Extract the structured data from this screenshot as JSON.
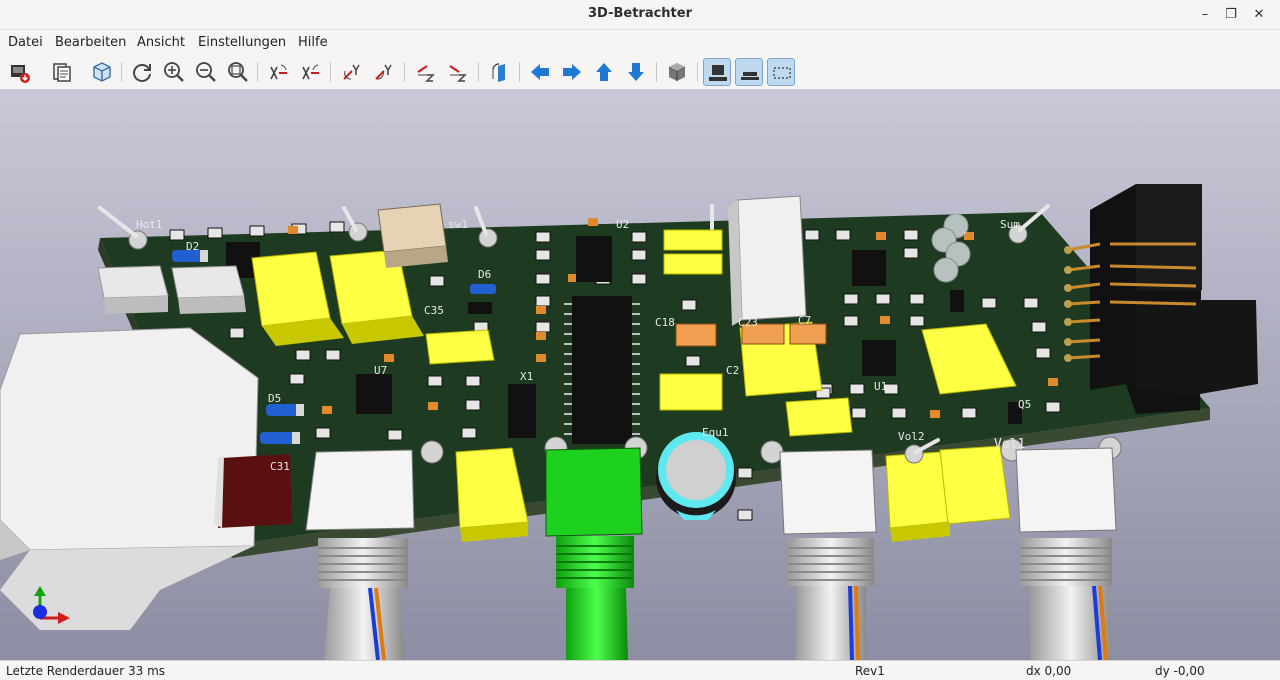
{
  "window": {
    "title": "3D-Betrachter"
  },
  "menu": [
    "Datei",
    "Bearbeiten",
    "Ansicht",
    "Einstellungen",
    "Hilfe"
  ],
  "toolbar": {
    "icons": [
      "export-image-icon",
      "copy-clipboard-icon",
      "raytrace-icon",
      "reload-icon",
      "zoom-in-icon",
      "zoom-out-icon",
      "zoom-fit-icon",
      "rotate-x-cw-icon",
      "rotate-x-ccw-icon",
      "rotate-y-cw-icon",
      "rotate-y-ccw-icon",
      "rotate-z-cw-icon",
      "rotate-z-ccw-icon",
      "flip-board-icon",
      "move-left-icon",
      "move-right-icon",
      "move-up-icon",
      "move-down-icon",
      "iso-view-icon",
      "perspective-icon",
      "orthographic-icon",
      "bounding-box-icon"
    ],
    "active": [
      "perspective-icon",
      "orthographic-icon",
      "bounding-box-icon"
    ]
  },
  "board": {
    "labels": {
      "hot1": "Hot1",
      "wsw1": "sw1",
      "sum": "Sum",
      "vol2": "Vol2",
      "vol1": "Vol1",
      "equ1": "Equ1",
      "c35": "C35",
      "c18": "C18",
      "c23": "C23",
      "c7": "C7",
      "c2": "C2",
      "c31": "C31",
      "d2": "D2",
      "d5": "D5",
      "d6": "D6",
      "u7": "U7",
      "u1": "U1",
      "u2": "U2",
      "x1": "X1",
      "q5": "Q5"
    },
    "colors": {
      "pcb": "#1e3a20",
      "background_top": "#c8c8d8",
      "background_bottom": "#8d8da3",
      "capacitor": "#ffff44",
      "pot": "#00d100"
    }
  },
  "status": {
    "render_time": "Letzte Renderdauer 33 ms",
    "board": "Rev1",
    "dx": "dx 0,00",
    "dy": "dy -0,00"
  }
}
